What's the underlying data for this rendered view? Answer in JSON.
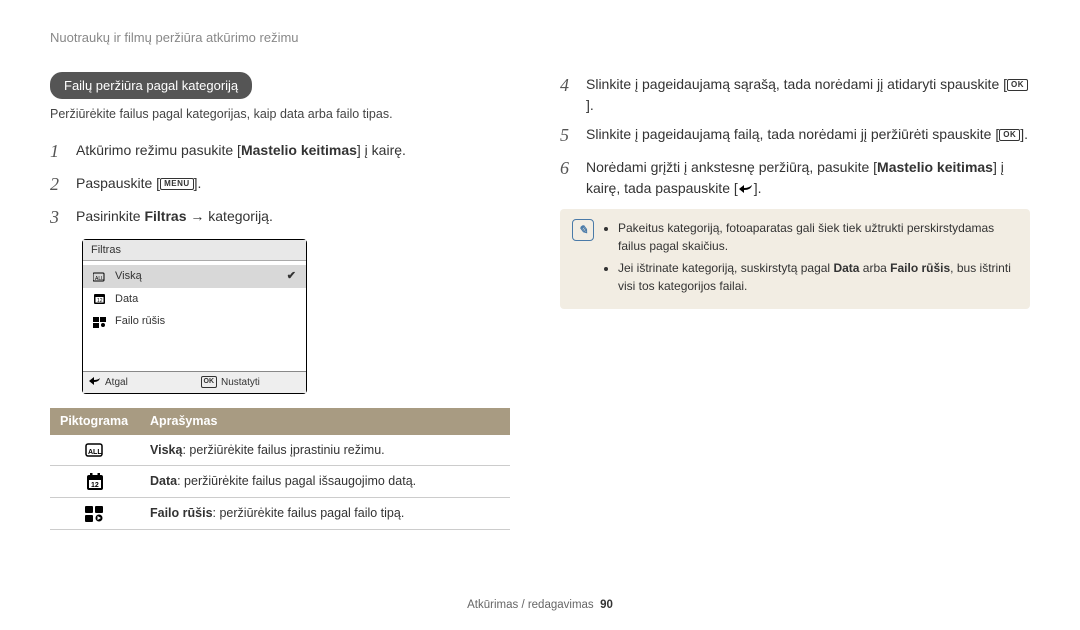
{
  "header": "Nuotraukų ir filmų peržiūra atkūrimo režimu",
  "left": {
    "badge": "Failų peržiūra pagal kategoriją",
    "subtext": "Peržiūrėkite failus pagal kategorijas, kaip data arba failo tipas.",
    "step1_a": "Atkūrimo režimu pasukite [",
    "step1_bold": "Mastelio keitimas",
    "step1_b": "] į kairę.",
    "step2_a": "Paspauskite [",
    "step2_btn": "MENU",
    "step2_b": "].",
    "step3_a": "Pasirinkite ",
    "step3_bold": "Filtras",
    "step3_b": " → kategoriją.",
    "screenshot": {
      "title": "Filtras",
      "items": [
        {
          "label": "Viską",
          "selected": true
        },
        {
          "label": "Data",
          "selected": false
        },
        {
          "label": "Failo rūšis",
          "selected": false
        }
      ],
      "foot_left": "Atgal",
      "foot_right_btn": "OK",
      "foot_right": "Nustatyti"
    },
    "table": {
      "head_icon": "Piktograma",
      "head_desc": "Aprašymas",
      "rows": [
        {
          "bold": "Viską",
          "rest": ": peržiūrėkite failus įprastiniu režimu."
        },
        {
          "bold": "Data",
          "rest": ": peržiūrėkite failus pagal išsaugojimo datą."
        },
        {
          "bold": "Failo rūšis",
          "rest": ": peržiūrėkite failus pagal failo tipą."
        }
      ]
    }
  },
  "right": {
    "step4_a": "Slinkite į pageidaujamą sąrašą, tada norėdami jį atidaryti spauskite [",
    "step4_btn": "OK",
    "step4_b": "].",
    "step5_a": "Slinkite į pageidaujamą failą, tada norėdami jį peržiūrėti spauskite [",
    "step5_btn": "OK",
    "step5_b": "].",
    "step6_a": "Norėdami grįžti į ankstesnę peržiūrą, pasukite [",
    "step6_bold": "Mastelio keitimas",
    "step6_b": "] į kairę, tada paspauskite [",
    "step6_c": "].",
    "info": {
      "li1": "Pakeitus kategoriją, fotoaparatas gali šiek tiek užtrukti perskirstydamas failus pagal skaičius.",
      "li2_a": "Jei ištrinate kategoriją, suskirstytą pagal ",
      "li2_b1": "Data",
      "li2_mid": " arba ",
      "li2_b2": "Failo rūšis",
      "li2_c": ", bus ištrinti visi tos kategorijos failai."
    }
  },
  "footer": {
    "section": "Atkūrimas / redagavimas",
    "page": "90"
  }
}
